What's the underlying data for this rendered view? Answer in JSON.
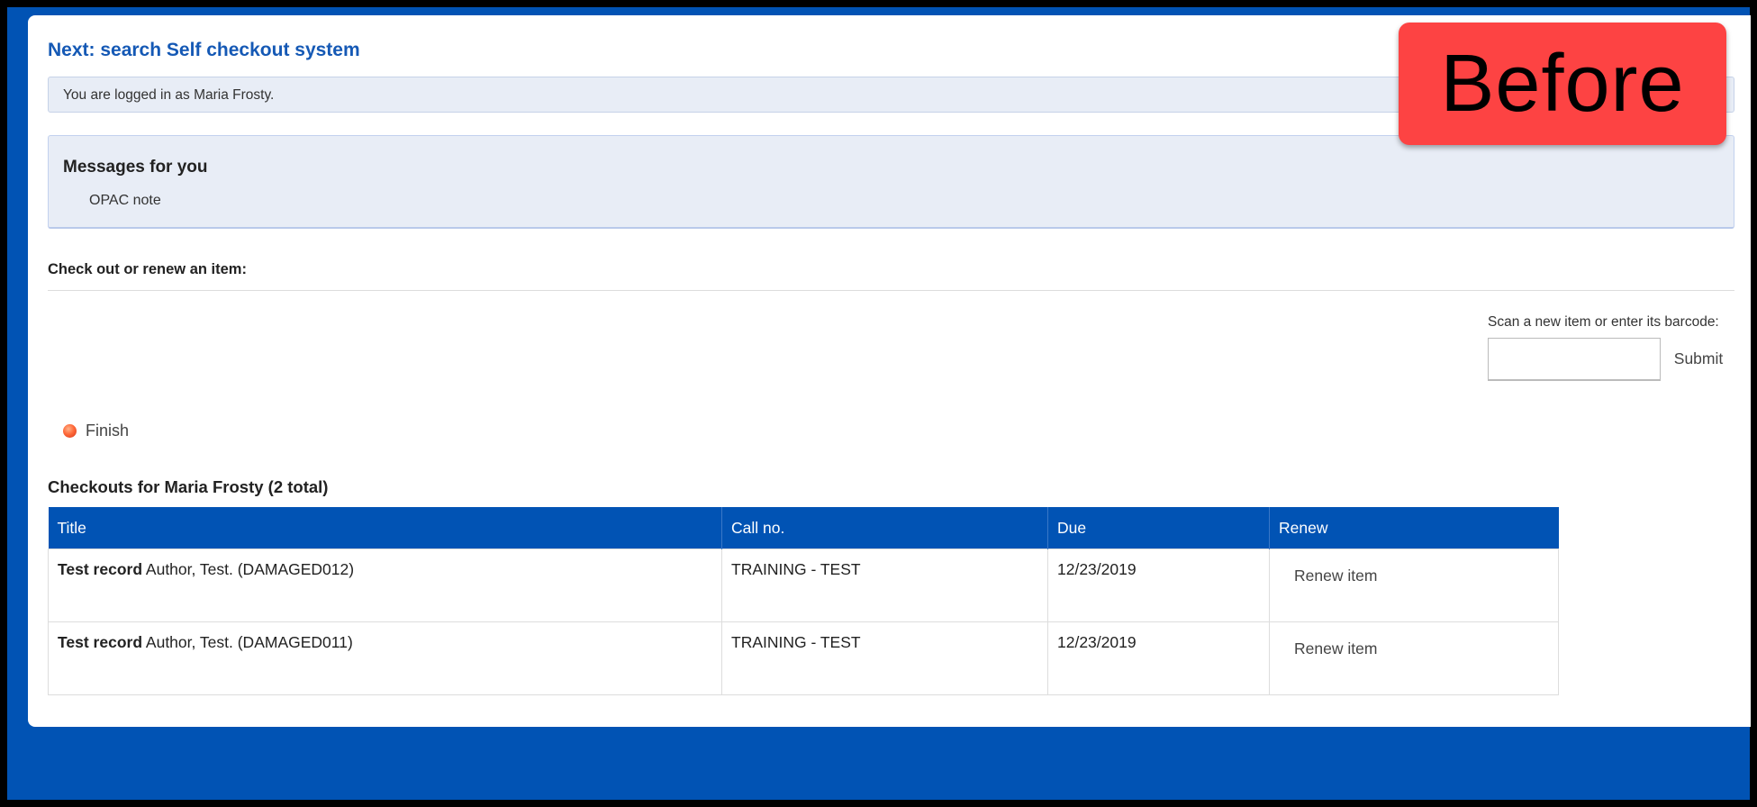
{
  "header": {
    "title": "Next: search Self checkout system",
    "login_message": "You are logged in as Maria Frosty."
  },
  "messages": {
    "heading": "Messages for you",
    "items": [
      "OPAC note"
    ]
  },
  "checkout_form": {
    "heading": "Check out or renew an item:",
    "barcode_label": "Scan a new item or enter its barcode:",
    "barcode_value": "",
    "submit_label": "Submit"
  },
  "finish": {
    "label": "Finish",
    "icon": "orange-dot-icon"
  },
  "checkouts": {
    "heading": "Checkouts for Maria Frosty (2 total)",
    "columns": [
      "Title",
      "Call no.",
      "Due",
      "Renew"
    ],
    "rows": [
      {
        "title_bold": "Test record",
        "title_rest": " Author, Test. (DAMAGED012)",
        "call_no": "TRAINING - TEST",
        "due": "12/23/2019",
        "renew": "Renew item"
      },
      {
        "title_bold": "Test record",
        "title_rest": " Author, Test. (DAMAGED011)",
        "call_no": "TRAINING - TEST",
        "due": "12/23/2019",
        "renew": "Renew item"
      }
    ]
  },
  "badge": {
    "label": "Before",
    "color": "#fd4343"
  },
  "colors": {
    "brand_blue": "#0153b4",
    "title_blue": "#1559b5",
    "panel_tint": "#e8edf6"
  }
}
